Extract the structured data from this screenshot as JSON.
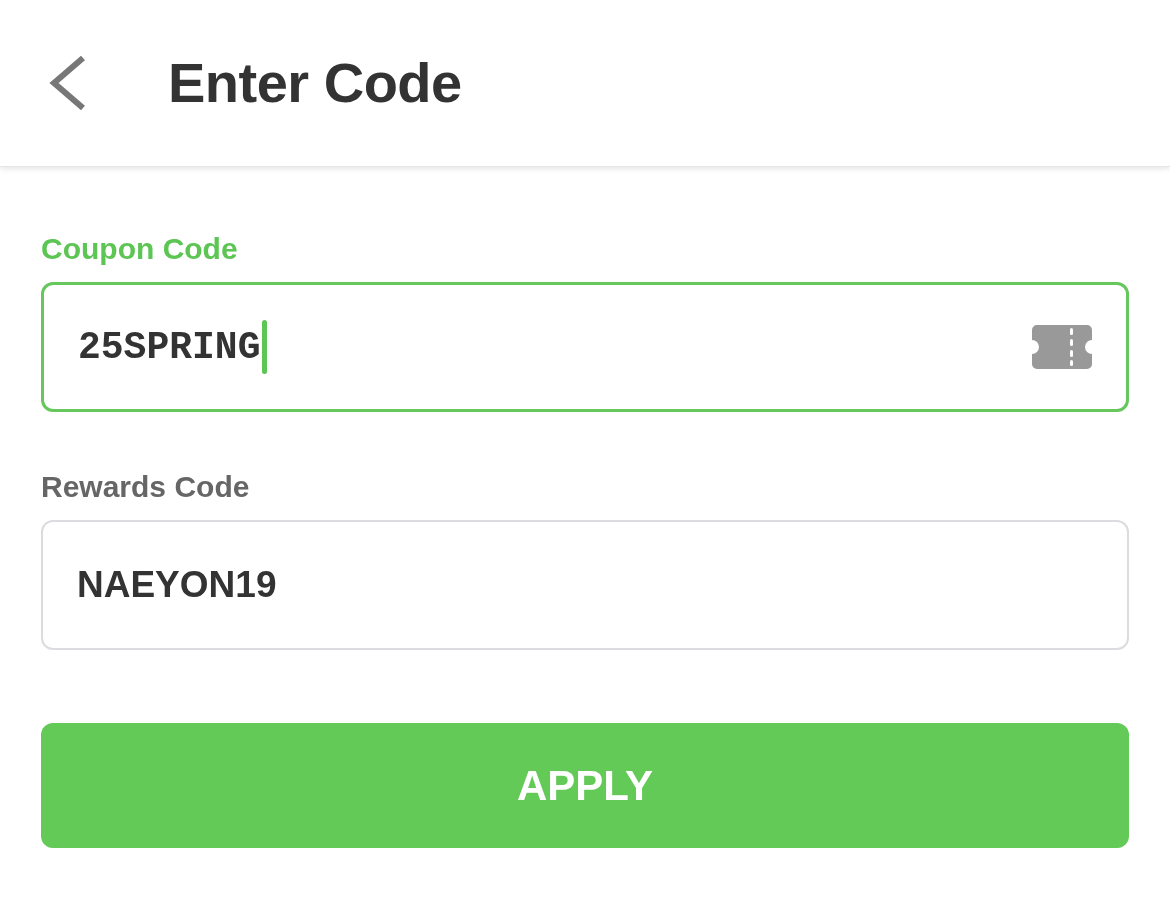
{
  "header": {
    "title": "Enter Code"
  },
  "fields": [
    {
      "kind": "coupon",
      "label": "Coupon Code",
      "value": "25SPRING",
      "focused": true
    },
    {
      "kind": "plain",
      "label": "Rewards Code",
      "value": "NAEYON19",
      "focused": false
    }
  ],
  "apply_button": {
    "label": "APPLY"
  }
}
